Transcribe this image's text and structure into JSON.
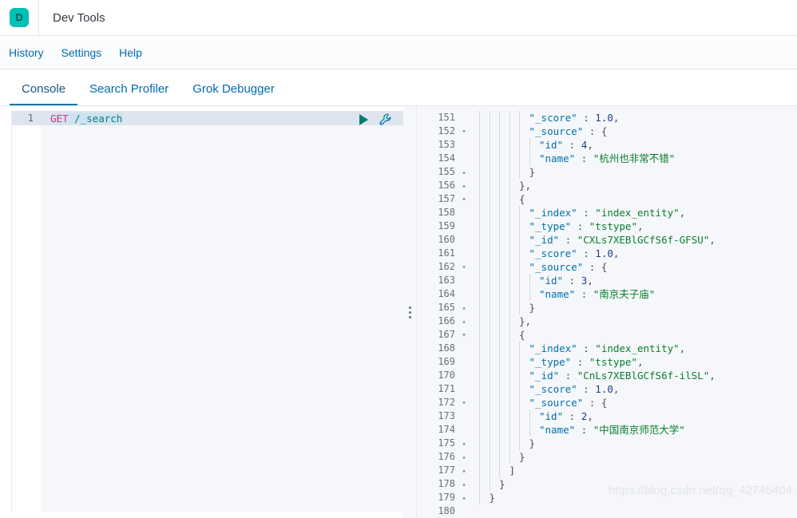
{
  "header": {
    "logo_letter": "D",
    "app_title": "Dev Tools"
  },
  "menu": {
    "items": [
      {
        "label": "History",
        "name": "menu-item-history"
      },
      {
        "label": "Settings",
        "name": "menu-item-settings"
      },
      {
        "label": "Help",
        "name": "menu-item-help"
      }
    ]
  },
  "tabs": {
    "items": [
      {
        "label": "Console",
        "active": true
      },
      {
        "label": "Search Profiler",
        "active": false
      },
      {
        "label": "Grok Debugger",
        "active": false
      }
    ]
  },
  "request_editor": {
    "line_number": "1",
    "method": "GET",
    "path": " /_search",
    "play_icon": "play-triangle-icon",
    "wrench_icon": "wrench-icon"
  },
  "response_editor": {
    "lines": [
      {
        "num": "151",
        "fold": "",
        "indent": 5,
        "tokens": [
          {
            "t": "\"_score\"",
            "c": "k"
          },
          {
            "t": " : ",
            "c": "p"
          },
          {
            "t": "1.0",
            "c": "n"
          },
          {
            "t": ",",
            "c": "p"
          }
        ]
      },
      {
        "num": "152",
        "fold": "▾",
        "indent": 5,
        "tokens": [
          {
            "t": "\"_source\"",
            "c": "k"
          },
          {
            "t": " : ",
            "c": "p"
          },
          {
            "t": "{",
            "c": "b"
          }
        ]
      },
      {
        "num": "153",
        "fold": "",
        "indent": 6,
        "tokens": [
          {
            "t": "\"id\"",
            "c": "k"
          },
          {
            "t": " : ",
            "c": "p"
          },
          {
            "t": "4",
            "c": "n"
          },
          {
            "t": ",",
            "c": "p"
          }
        ]
      },
      {
        "num": "154",
        "fold": "",
        "indent": 6,
        "tokens": [
          {
            "t": "\"name\"",
            "c": "k"
          },
          {
            "t": " : ",
            "c": "p"
          },
          {
            "t": "\"杭州也非常不错\"",
            "c": "s"
          }
        ]
      },
      {
        "num": "155",
        "fold": "▴",
        "indent": 5,
        "tokens": [
          {
            "t": "}",
            "c": "b"
          }
        ]
      },
      {
        "num": "156",
        "fold": "▴",
        "indent": 4,
        "tokens": [
          {
            "t": "},",
            "c": "b"
          }
        ]
      },
      {
        "num": "157",
        "fold": "▾",
        "indent": 4,
        "tokens": [
          {
            "t": "{",
            "c": "b"
          }
        ]
      },
      {
        "num": "158",
        "fold": "",
        "indent": 5,
        "tokens": [
          {
            "t": "\"_index\"",
            "c": "k"
          },
          {
            "t": " : ",
            "c": "p"
          },
          {
            "t": "\"index_entity\"",
            "c": "s"
          },
          {
            "t": ",",
            "c": "p"
          }
        ]
      },
      {
        "num": "159",
        "fold": "",
        "indent": 5,
        "tokens": [
          {
            "t": "\"_type\"",
            "c": "k"
          },
          {
            "t": " : ",
            "c": "p"
          },
          {
            "t": "\"tstype\"",
            "c": "s"
          },
          {
            "t": ",",
            "c": "p"
          }
        ]
      },
      {
        "num": "160",
        "fold": "",
        "indent": 5,
        "tokens": [
          {
            "t": "\"_id\"",
            "c": "k"
          },
          {
            "t": " : ",
            "c": "p"
          },
          {
            "t": "\"CXLs7XEBlGCfS6f-GFSU\"",
            "c": "s"
          },
          {
            "t": ",",
            "c": "p"
          }
        ]
      },
      {
        "num": "161",
        "fold": "",
        "indent": 5,
        "tokens": [
          {
            "t": "\"_score\"",
            "c": "k"
          },
          {
            "t": " : ",
            "c": "p"
          },
          {
            "t": "1.0",
            "c": "n"
          },
          {
            "t": ",",
            "c": "p"
          }
        ]
      },
      {
        "num": "162",
        "fold": "▾",
        "indent": 5,
        "tokens": [
          {
            "t": "\"_source\"",
            "c": "k"
          },
          {
            "t": " : ",
            "c": "p"
          },
          {
            "t": "{",
            "c": "b"
          }
        ]
      },
      {
        "num": "163",
        "fold": "",
        "indent": 6,
        "tokens": [
          {
            "t": "\"id\"",
            "c": "k"
          },
          {
            "t": " : ",
            "c": "p"
          },
          {
            "t": "3",
            "c": "n"
          },
          {
            "t": ",",
            "c": "p"
          }
        ]
      },
      {
        "num": "164",
        "fold": "",
        "indent": 6,
        "tokens": [
          {
            "t": "\"name\"",
            "c": "k"
          },
          {
            "t": " : ",
            "c": "p"
          },
          {
            "t": "\"南京夫子庙\"",
            "c": "s"
          }
        ]
      },
      {
        "num": "165",
        "fold": "▴",
        "indent": 5,
        "tokens": [
          {
            "t": "}",
            "c": "b"
          }
        ]
      },
      {
        "num": "166",
        "fold": "▴",
        "indent": 4,
        "tokens": [
          {
            "t": "},",
            "c": "b"
          }
        ]
      },
      {
        "num": "167",
        "fold": "▾",
        "indent": 4,
        "tokens": [
          {
            "t": "{",
            "c": "b"
          }
        ]
      },
      {
        "num": "168",
        "fold": "",
        "indent": 5,
        "tokens": [
          {
            "t": "\"_index\"",
            "c": "k"
          },
          {
            "t": " : ",
            "c": "p"
          },
          {
            "t": "\"index_entity\"",
            "c": "s"
          },
          {
            "t": ",",
            "c": "p"
          }
        ]
      },
      {
        "num": "169",
        "fold": "",
        "indent": 5,
        "tokens": [
          {
            "t": "\"_type\"",
            "c": "k"
          },
          {
            "t": " : ",
            "c": "p"
          },
          {
            "t": "\"tstype\"",
            "c": "s"
          },
          {
            "t": ",",
            "c": "p"
          }
        ]
      },
      {
        "num": "170",
        "fold": "",
        "indent": 5,
        "tokens": [
          {
            "t": "\"_id\"",
            "c": "k"
          },
          {
            "t": " : ",
            "c": "p"
          },
          {
            "t": "\"CnLs7XEBlGCfS6f-ilSL\"",
            "c": "s"
          },
          {
            "t": ",",
            "c": "p"
          }
        ]
      },
      {
        "num": "171",
        "fold": "",
        "indent": 5,
        "tokens": [
          {
            "t": "\"_score\"",
            "c": "k"
          },
          {
            "t": " : ",
            "c": "p"
          },
          {
            "t": "1.0",
            "c": "n"
          },
          {
            "t": ",",
            "c": "p"
          }
        ]
      },
      {
        "num": "172",
        "fold": "▾",
        "indent": 5,
        "tokens": [
          {
            "t": "\"_source\"",
            "c": "k"
          },
          {
            "t": " : ",
            "c": "p"
          },
          {
            "t": "{",
            "c": "b"
          }
        ]
      },
      {
        "num": "173",
        "fold": "",
        "indent": 6,
        "tokens": [
          {
            "t": "\"id\"",
            "c": "k"
          },
          {
            "t": " : ",
            "c": "p"
          },
          {
            "t": "2",
            "c": "n"
          },
          {
            "t": ",",
            "c": "p"
          }
        ]
      },
      {
        "num": "174",
        "fold": "",
        "indent": 6,
        "tokens": [
          {
            "t": "\"name\"",
            "c": "k"
          },
          {
            "t": " : ",
            "c": "p"
          },
          {
            "t": "\"中国南京师范大学\"",
            "c": "s"
          }
        ]
      },
      {
        "num": "175",
        "fold": "▴",
        "indent": 5,
        "tokens": [
          {
            "t": "}",
            "c": "b"
          }
        ]
      },
      {
        "num": "176",
        "fold": "▴",
        "indent": 4,
        "tokens": [
          {
            "t": "}",
            "c": "b"
          }
        ]
      },
      {
        "num": "177",
        "fold": "▴",
        "indent": 3,
        "tokens": [
          {
            "t": "]",
            "c": "b"
          }
        ]
      },
      {
        "num": "178",
        "fold": "▴",
        "indent": 2,
        "tokens": [
          {
            "t": "}",
            "c": "b"
          }
        ]
      },
      {
        "num": "179",
        "fold": "▴",
        "indent": 1,
        "tokens": [
          {
            "t": "}",
            "c": "b"
          }
        ]
      },
      {
        "num": "180",
        "fold": "",
        "indent": 0,
        "tokens": []
      }
    ]
  },
  "watermark": {
    "text": "https://blog.csdn.net/qq_42745404"
  },
  "colors": {
    "brand_teal": "#00bfb3",
    "link_blue": "#006bb4",
    "active_tab": "#0079a5",
    "json_key": "#0070ac",
    "json_string": "#0a7d2e",
    "json_number": "#1a3e8c",
    "method_pink": "#d5357c",
    "url_teal": "#0a7b83"
  }
}
